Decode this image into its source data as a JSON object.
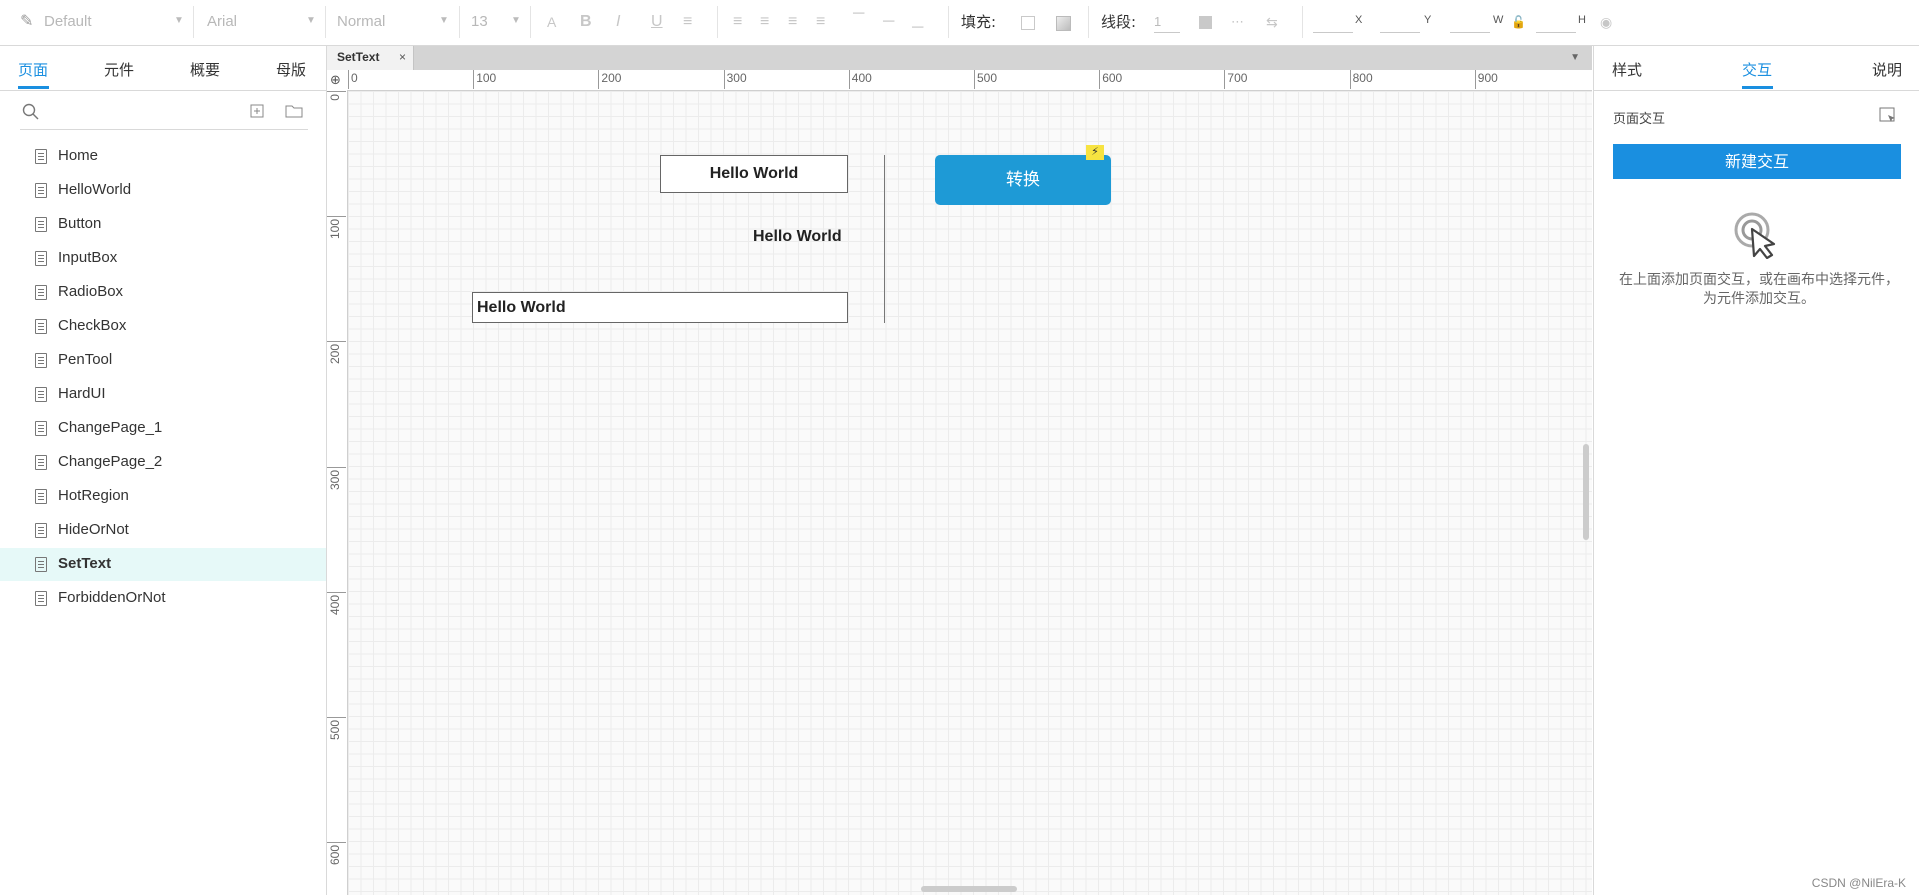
{
  "toolbar": {
    "style_select": "Default",
    "font_select": "Arial",
    "weight_select": "Normal",
    "size_select": "13",
    "fill_label": "填充:",
    "line_label": "线段:",
    "line_value": "1",
    "x_label": "X",
    "y_label": "Y",
    "w_label": "W",
    "h_label": "H"
  },
  "left_panel": {
    "tabs": [
      "页面",
      "元件",
      "概要",
      "母版"
    ],
    "active_tab": "页面",
    "pages": [
      "Home",
      "HelloWorld",
      "Button",
      "InputBox",
      "RadioBox",
      "CheckBox",
      "PenTool",
      "HardUI",
      "ChangePage_1",
      "ChangePage_2",
      "HotRegion",
      "HideOrNot",
      "SetText",
      "ForbiddenOrNot"
    ],
    "active_page": "SetText"
  },
  "canvas": {
    "doc_tab": "SetText",
    "ruler_top": [
      "0",
      "100",
      "200",
      "300",
      "400",
      "500",
      "600",
      "700",
      "800",
      "900"
    ],
    "ruler_left": [
      "0",
      "100",
      "200",
      "300",
      "400",
      "500",
      "600"
    ],
    "widgets": {
      "box1_text": "Hello World",
      "label_text": "Hello World",
      "box2_text": "Hello World",
      "button_text": "转换"
    }
  },
  "right_panel": {
    "tabs": [
      "样式",
      "交互",
      "说明"
    ],
    "active_tab": "交互",
    "section_title": "页面交互",
    "new_button": "新建交互",
    "hint": "在上面添加页面交互，或在画布中选择元件，为元件添加交互。"
  },
  "watermark": "CSDN @NilEra-K",
  "colors": {
    "accent": "#1a8fe0",
    "button": "#1e9ad6",
    "selected_row": "#e6f9f8"
  }
}
